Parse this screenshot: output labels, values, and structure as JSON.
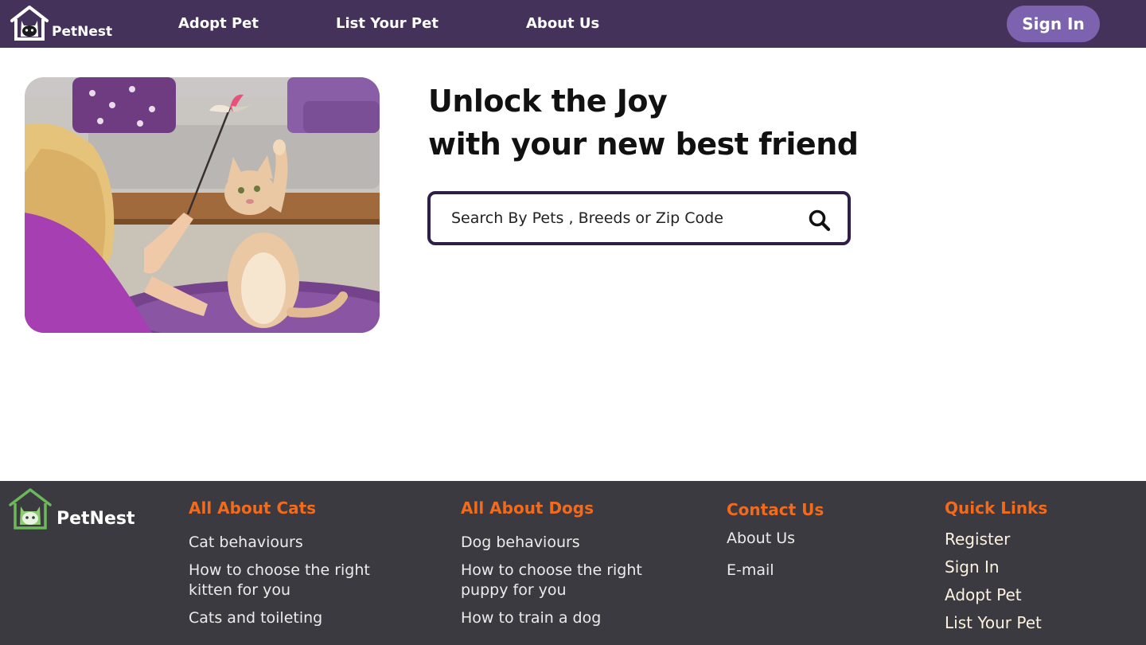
{
  "header": {
    "brand": "PetNest",
    "nav": [
      {
        "label": "Adopt Pet"
      },
      {
        "label": "List Your Pet"
      },
      {
        "label": "About Us"
      }
    ],
    "sign_in": "Sign In"
  },
  "hero": {
    "title_line1": "Unlock the Joy",
    "title_line2": "with your new best friend",
    "image_alt": "girl-playing-with-cat"
  },
  "search": {
    "placeholder": "Search By Pets , Breeds or Zip Code",
    "value": "",
    "icon": "search-icon"
  },
  "footer": {
    "brand": "PetNest",
    "columns": [
      {
        "heading": "All About Cats",
        "links": [
          "Cat behaviours",
          "How to choose the right kitten for you",
          "Cats and toileting"
        ]
      },
      {
        "heading": "All About Dogs",
        "links": [
          "Dog behaviours",
          "How to choose the right puppy for you",
          "How to train a dog"
        ]
      },
      {
        "heading": "Contact Us",
        "links": [
          "About Us",
          "E-mail"
        ]
      },
      {
        "heading": "Quick Links",
        "links": [
          "Register",
          "Sign In",
          "Adopt Pet",
          "List Your Pet"
        ]
      }
    ]
  },
  "colors": {
    "header_bg": "#45325a",
    "sign_in_bg": "#7d62b0",
    "footer_bg": "#3b3a40",
    "footer_heading": "#f26a1b",
    "footer_logo_green": "#6cb85b"
  }
}
